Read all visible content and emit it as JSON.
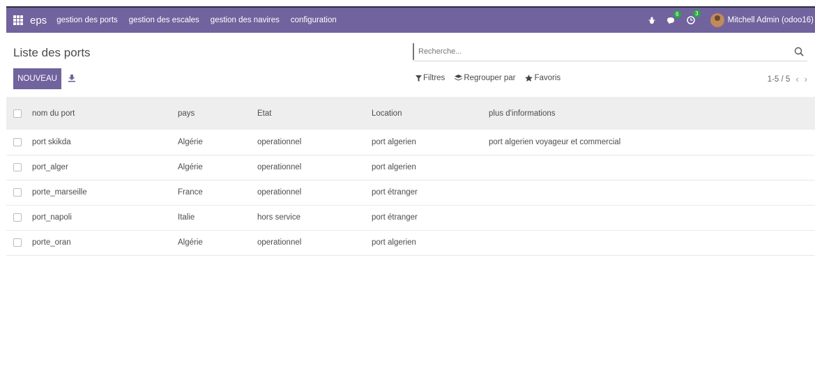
{
  "navbar": {
    "brand": "eps",
    "menu": [
      "gestion des ports",
      "gestion des escales",
      "gestion des navires",
      "configuration"
    ],
    "messages_count": "6",
    "activities_count": "3",
    "user_name": "Mitchell Admin (odoo16)"
  },
  "page": {
    "title": "Liste des ports",
    "search_placeholder": "Recherche...",
    "new_button": "Nouveau",
    "filters_label": "Filtres",
    "group_by_label": "Regrouper par",
    "favorites_label": "Favoris",
    "pager": "1-5 / 5"
  },
  "table": {
    "headers": [
      "nom du port",
      "pays",
      "Etat",
      "Location",
      "plus d'informations"
    ],
    "rows": [
      [
        "port skikda",
        "Algérie",
        "operationnel",
        "port algerien",
        "port algerien voyageur et commercial"
      ],
      [
        "port_alger",
        "Algérie",
        "operationnel",
        "port algerien",
        ""
      ],
      [
        "porte_marseille",
        "France",
        "operationnel",
        "port étranger",
        ""
      ],
      [
        "port_napoli",
        "Italie",
        "hors service",
        "port étranger",
        ""
      ],
      [
        "porte_oran",
        "Algérie",
        "operationnel",
        "port algerien",
        ""
      ]
    ]
  },
  "colors": {
    "navbar": "#71639e",
    "badge": "#28a745"
  },
  "icons": [
    "apps-grid-icon",
    "bug-icon",
    "chat-icon",
    "clock-icon",
    "search-icon",
    "download-icon",
    "filter-icon",
    "layers-icon",
    "star-icon",
    "chevron-left-icon",
    "chevron-right-icon"
  ]
}
